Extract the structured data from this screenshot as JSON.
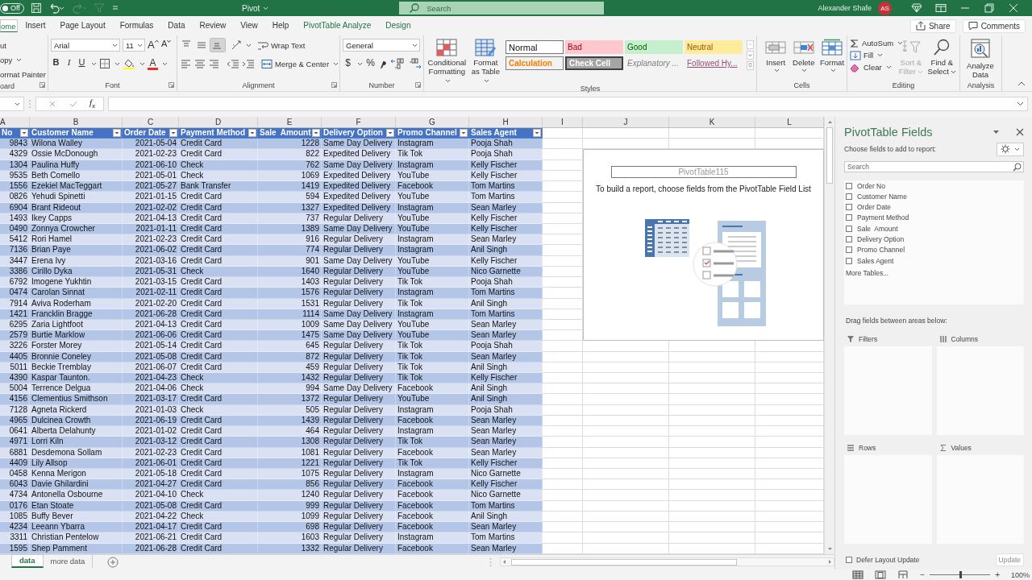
{
  "title_bar": {
    "autosave": {
      "label": "Off",
      "on": false
    },
    "title": "Pivot",
    "search": {
      "placeholder": "Search"
    },
    "user_name": "Alexander Shafe",
    "avatar": "AS"
  },
  "ribbon_tabs": [
    {
      "label": "ome",
      "selected": true,
      "kind": "standard"
    },
    {
      "label": "Insert",
      "selected": false,
      "kind": "standard"
    },
    {
      "label": "Page Layout",
      "selected": false,
      "kind": "standard"
    },
    {
      "label": "Formulas",
      "selected": false,
      "kind": "standard"
    },
    {
      "label": "Data",
      "selected": false,
      "kind": "standard"
    },
    {
      "label": "Review",
      "selected": false,
      "kind": "standard"
    },
    {
      "label": "View",
      "selected": false,
      "kind": "standard"
    },
    {
      "label": "Help",
      "selected": false,
      "kind": "standard"
    },
    {
      "label": "PivotTable Analyze",
      "selected": false,
      "kind": "contextual"
    },
    {
      "label": "Design",
      "selected": false,
      "kind": "contextual"
    }
  ],
  "share_button": "Share",
  "comments_button": "Comments",
  "ribbon": {
    "clipboard": {
      "items": [
        "ut",
        "opy",
        "ormat Painter"
      ],
      "label": "oard"
    },
    "font": {
      "font_name": "Arial",
      "font_size": "11",
      "grow": "A",
      "shrink": "A",
      "bold": "B",
      "italic": "I",
      "underline": "U",
      "font_color": "A",
      "label": "Font"
    },
    "alignment": {
      "vertical_align_buttons": [
        {
          "kind": "top",
          "selected": false
        },
        {
          "kind": "middle",
          "selected": false
        },
        {
          "kind": "bottom",
          "selected": true
        }
      ],
      "wrap_text": "Wrap Text",
      "merge": "Merge & Center",
      "label": "Alignment"
    },
    "number": {
      "format": "General",
      "currency": "$",
      "percent": "%",
      "label": "Number"
    },
    "styles": {
      "conditional_formatting": "Conditional Formatting",
      "format_as_table": "Format as Table",
      "gallery": [
        {
          "label": "Normal",
          "kind": "normal"
        },
        {
          "label": "Bad",
          "kind": "bad"
        },
        {
          "label": "Good",
          "kind": "good"
        },
        {
          "label": "Neutral",
          "kind": "neutral"
        },
        {
          "label": "Calculation",
          "kind": "calculation"
        },
        {
          "label": "Check Cell",
          "kind": "check"
        },
        {
          "label": "Explanatory ...",
          "kind": "explanatory"
        },
        {
          "label": "Followed Hy...",
          "kind": "followed"
        }
      ],
      "label": "Styles"
    },
    "cells": {
      "buttons": [
        {
          "label": "Insert",
          "kind": "insert"
        },
        {
          "label": "Delete",
          "kind": "delete"
        },
        {
          "label": "Format",
          "kind": "format"
        }
      ],
      "label": "Cells"
    },
    "editing": {
      "items": [
        {
          "label": "AutoSum",
          "kind": "autosum"
        },
        {
          "label": "Fill",
          "kind": "fill"
        },
        {
          "label": "Clear",
          "kind": "clear"
        }
      ],
      "sort_filter": {
        "label": "Sort & Filter",
        "disabled": true
      },
      "find_select": "Find & Select",
      "label": "Editing"
    },
    "analysis": {
      "button": "Analyze Data",
      "label": "Analysis"
    }
  },
  "formula_bar": {
    "function_label": "f$_{x}$"
  },
  "column_letters": [
    "A",
    "B",
    "C",
    "D",
    "E",
    "F",
    "G",
    "H",
    "I",
    "J",
    "K",
    "L"
  ],
  "table": {
    "columns": [
      "No",
      "Customer Name",
      "Order Date",
      "Payment Method",
      "Sale  Amount",
      "Delivery Option",
      "Promo Channel",
      "Sales Agent"
    ],
    "rows": [
      [
        "9843",
        "Wilona Walley",
        "2021-05-04",
        "Credit Card",
        "1228",
        "Same Day Delivery",
        "Instagram",
        "Pooja Shah"
      ],
      [
        "4329",
        "Ossie McDonough",
        "2021-02-23",
        "Credit Card",
        "822",
        "Expedited Delivery",
        "Tik Tok",
        "Pooja Shah"
      ],
      [
        "1304",
        "Paulina Huffy",
        "2021-06-10",
        "Check",
        "762",
        "Same Day Delivery",
        "Instagram",
        "Kelly Fischer"
      ],
      [
        "9535",
        "Beth Comello",
        "2021-05-01",
        "Check",
        "1069",
        "Expedited Delivery",
        "YouTube",
        "Kelly Fischer"
      ],
      [
        "1556",
        "Ezekiel MacTeggart",
        "2021-05-27",
        "Bank Transfer",
        "1419",
        "Expedited Delivery",
        "Facebook",
        "Tom Martins"
      ],
      [
        "0826",
        "Yehudi Spinetti",
        "2021-01-15",
        "Credit Card",
        "594",
        "Expedited Delivery",
        "YouTube",
        "Tom Martins"
      ],
      [
        "6904",
        "Brant Rideout",
        "2021-02-02",
        "Credit Card",
        "1327",
        "Expedited Delivery",
        "Instagram",
        "Sean Marley"
      ],
      [
        "1493",
        "Ikey Capps",
        "2021-04-13",
        "Credit Card",
        "737",
        "Regular Delivery",
        "YouTube",
        "Kelly Fischer"
      ],
      [
        "0490",
        "Zonnya Crowcher",
        "2021-01-11",
        "Credit Card",
        "1389",
        "Same Day Delivery",
        "YouTube",
        "Kelly Fischer"
      ],
      [
        "5412",
        "Rori Hamel",
        "2021-02-23",
        "Credit Card",
        "916",
        "Regular Delivery",
        "Instagram",
        "Sean Marley"
      ],
      [
        "7136",
        "Brian Paye",
        "2021-06-02",
        "Credit Card",
        "774",
        "Regular Delivery",
        "Instagram",
        "Anil Singh"
      ],
      [
        "3447",
        "Erena Ivy",
        "2021-03-16",
        "Credit Card",
        "901",
        "Same Day Delivery",
        "YouTube",
        "Kelly Fischer"
      ],
      [
        "3386",
        "Cirillo Dyka",
        "2021-05-31",
        "Check",
        "1640",
        "Regular Delivery",
        "YouTube",
        "Nico Garnette"
      ],
      [
        "6792",
        "Imogene Yukhtin",
        "2021-03-15",
        "Credit Card",
        "1403",
        "Regular Delivery",
        "Tik Tok",
        "Pooja Shah"
      ],
      [
        "0474",
        "Carolan Sinnat",
        "2021-02-11",
        "Credit Card",
        "1576",
        "Regular Delivery",
        "Instagram",
        "Tom Martins"
      ],
      [
        "7914",
        "Aviva Roderham",
        "2021-02-20",
        "Credit Card",
        "1531",
        "Regular Delivery",
        "Tik Tok",
        "Anil Singh"
      ],
      [
        "1421",
        "Francklin Bragge",
        "2021-06-28",
        "Credit Card",
        "1114",
        "Same Day Delivery",
        "Instagram",
        "Tom Martins"
      ],
      [
        "6295",
        "Zaria Lightfoot",
        "2021-04-13",
        "Credit Card",
        "1009",
        "Same Day Delivery",
        "YouTube",
        "Sean Marley"
      ],
      [
        "2579",
        "Burtie Marklow",
        "2021-06-06",
        "Credit Card",
        "1475",
        "Same Day Delivery",
        "YouTube",
        "Sean Marley"
      ],
      [
        "3226",
        "Forster Morey",
        "2021-05-14",
        "Credit Card",
        "645",
        "Regular Delivery",
        "Tik Tok",
        "Pooja Shah"
      ],
      [
        "4405",
        "Bronnie Coneley",
        "2021-05-08",
        "Credit Card",
        "872",
        "Regular Delivery",
        "Tik Tok",
        "Sean Marley"
      ],
      [
        "5011",
        "Beckie Tremblay",
        "2021-06-07",
        "Credit Card",
        "459",
        "Regular Delivery",
        "Tik Tok",
        "Anil Singh"
      ],
      [
        "4390",
        "Kaspar Taunton.",
        "2021-04-23",
        "Check",
        "1432",
        "Regular Delivery",
        "Tik Tok",
        "Kelly Fischer"
      ],
      [
        "5004",
        "Terrence Delgua",
        "2021-04-06",
        "Check",
        "994",
        "Same Day Delivery",
        "Facebook",
        "Anil Singh"
      ],
      [
        "4156",
        "Clementius Smithson",
        "2021-03-17",
        "Credit Card",
        "1372",
        "Regular Delivery",
        "YouTube",
        "Anil Singh"
      ],
      [
        "7128",
        "Agneta Rickerd",
        "2021-01-03",
        "Check",
        "505",
        "Regular Delivery",
        "Instagram",
        "Pooja Shah"
      ],
      [
        "4965",
        "Dulcinea Crowth",
        "2021-06-19",
        "Credit Card",
        "1439",
        "Regular Delivery",
        "Facebook",
        "Sean Marley"
      ],
      [
        "0641",
        "Alberta Delahunty",
        "2021-01-02",
        "Credit Card",
        "464",
        "Regular Delivery",
        "Instagram",
        "Sean Marley"
      ],
      [
        "4971",
        "Lorri Kiln",
        "2021-03-12",
        "Credit Card",
        "1308",
        "Regular Delivery",
        "Tik Tok",
        "Sean Marley"
      ],
      [
        "6881",
        "Desdemona Sollam",
        "2021-02-23",
        "Credit Card",
        "1081",
        "Regular Delivery",
        "Facebook",
        "Sean Marley"
      ],
      [
        "4409",
        "Lily Allsop",
        "2021-06-01",
        "Credit Card",
        "1221",
        "Regular Delivery",
        "Tik Tok",
        "Kelly Fischer"
      ],
      [
        "0458",
        "Kenna Merigon",
        "2021-05-18",
        "Credit Card",
        "1075",
        "Regular Delivery",
        "Instagram",
        "Nico Garnette"
      ],
      [
        "6043",
        "Davie Ghilardini",
        "2021-04-27",
        "Credit Card",
        "856",
        "Regular Delivery",
        "Facebook",
        "Kelly Fischer"
      ],
      [
        "4734",
        "Antonella Osbourne",
        "2021-04-10",
        "Check",
        "1240",
        "Regular Delivery",
        "Facebook",
        "Nico Garnette"
      ],
      [
        "0176",
        "Etan Stoate",
        "2021-05-08",
        "Credit Card",
        "999",
        "Regular Delivery",
        "Facebook",
        "Tom Martins"
      ],
      [
        "1085",
        "Buffy Bever",
        "2021-04-22",
        "Check",
        "1099",
        "Regular Delivery",
        "Facebook",
        "Anil Singh"
      ],
      [
        "4234",
        "Leeann Ybarra",
        "2021-04-17",
        "Credit Card",
        "698",
        "Regular Delivery",
        "Facebook",
        "Sean Marley"
      ],
      [
        "3311",
        "Christian Pentelow",
        "2021-06-21",
        "Credit Card",
        "1603",
        "Regular Delivery",
        "Instagram",
        "Tom Martins"
      ],
      [
        "1595",
        "Shep Pamment",
        "2021-06-28",
        "Credit Card",
        "1332",
        "Regular Delivery",
        "Facebook",
        "Sean Marley"
      ]
    ]
  },
  "pivot_placeholder": {
    "name": "PivotTable115",
    "instruction": "To build a report, choose fields from the PivotTable Field List"
  },
  "pivot_panel": {
    "title": "PivotTable Fields",
    "choose_label": "Choose fields to add to report:",
    "search": {
      "placeholder": "Search"
    },
    "fields": [
      {
        "label": "Order No",
        "checked": false
      },
      {
        "label": "Customer Name",
        "checked": false
      },
      {
        "label": "Order Date",
        "checked": false
      },
      {
        "label": "Payment Method",
        "checked": false
      },
      {
        "label": "Sale  Amount",
        "checked": false
      },
      {
        "label": "Delivery Option",
        "checked": false
      },
      {
        "label": "Promo Channel",
        "checked": false
      },
      {
        "label": "Sales Agent",
        "checked": false
      }
    ],
    "more_tables": "More Tables...",
    "drag_label": "Drag fields between areas below:",
    "areas": [
      {
        "label": "Filters",
        "kind": "filters"
      },
      {
        "label": "Columns",
        "kind": "columns"
      },
      {
        "label": "Rows",
        "kind": "rows"
      },
      {
        "label": "Values",
        "kind": "values"
      }
    ],
    "defer_update": {
      "label": "Defer Layout Update",
      "checked": false
    },
    "update_button": {
      "label": "Update",
      "disabled": true
    }
  },
  "sheet_tabs": [
    {
      "label": "data",
      "selected": true
    },
    {
      "label": "more data",
      "selected": false
    }
  ],
  "status_bar": {
    "views": [
      {
        "kind": "normal",
        "selected": true
      },
      {
        "kind": "page_layout",
        "selected": false
      },
      {
        "kind": "page_break",
        "selected": false
      }
    ],
    "zoom": {
      "out": "−",
      "in": "+",
      "level": 0.5,
      "reading": "100%"
    }
  }
}
